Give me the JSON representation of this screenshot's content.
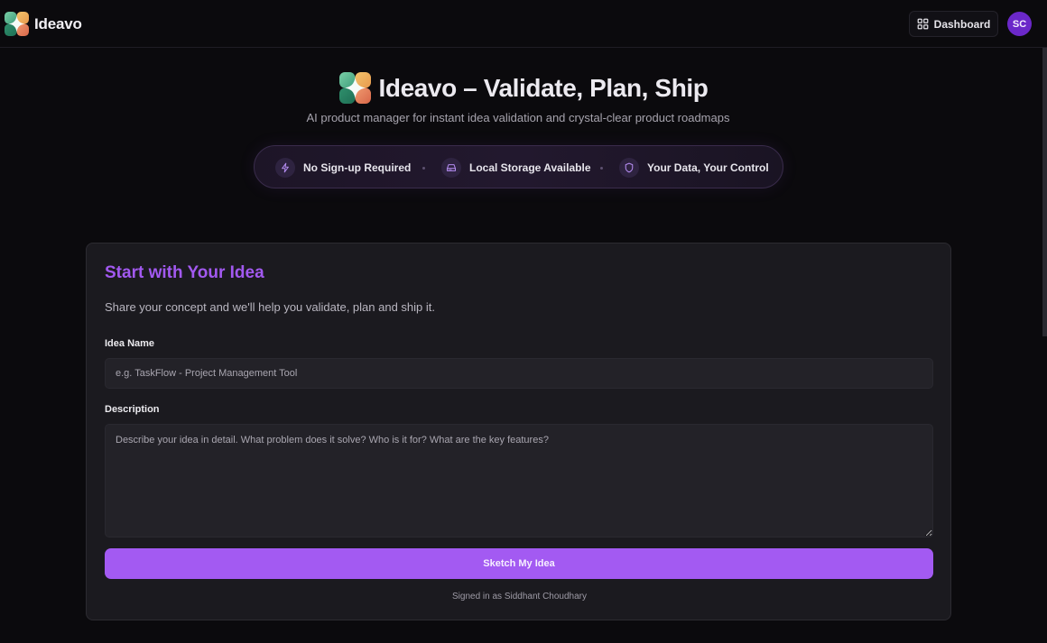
{
  "header": {
    "brand_name": "Ideavo",
    "dashboard_label": "Dashboard",
    "avatar_initials": "SC"
  },
  "hero": {
    "title": "Ideavo – Validate, Plan, Ship",
    "subtitle": "AI product manager for instant idea validation and crystal-clear product roadmaps"
  },
  "features": [
    {
      "icon": "lightning-icon",
      "label": "No Sign-up Required"
    },
    {
      "icon": "storage-icon",
      "label": "Local Storage Available"
    },
    {
      "icon": "shield-icon",
      "label": "Your Data, Your Control"
    }
  ],
  "form": {
    "title": "Start with Your Idea",
    "description": "Share your concept and we'll help you validate, plan and ship it.",
    "idea_name_label": "Idea Name",
    "idea_name_placeholder": "e.g. TaskFlow - Project Management Tool",
    "idea_name_value": "",
    "description_label": "Description",
    "description_placeholder": "Describe your idea in detail. What problem does it solve? Who is it for? What are the key features?",
    "description_value": "",
    "submit_label": "Sketch My Idea",
    "signed_in_text": "Signed in as Siddhant Choudhary"
  },
  "colors": {
    "accent": "#a35af2",
    "title_accent": "#a259f0",
    "background": "#0b0a0d",
    "card": "#1b1a1f",
    "avatar": "#6b28c9"
  }
}
